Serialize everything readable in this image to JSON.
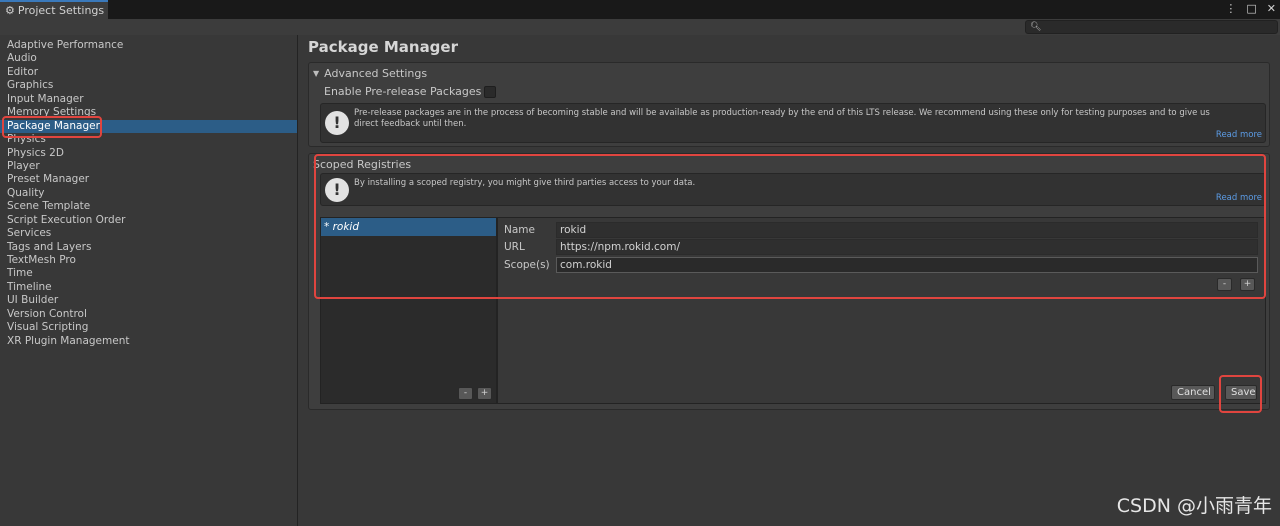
{
  "window": {
    "tab_title": "Project Settings",
    "menu_glyph": "⋮",
    "maximize_glyph": "□",
    "close_glyph": "✕"
  },
  "search": {
    "placeholder": "",
    "value": ""
  },
  "sidebar": {
    "items": [
      {
        "label": "Adaptive Performance"
      },
      {
        "label": "Audio"
      },
      {
        "label": "Editor"
      },
      {
        "label": "Graphics"
      },
      {
        "label": "Input Manager"
      },
      {
        "label": "Memory Settings"
      },
      {
        "label": "Package Manager",
        "selected": true
      },
      {
        "label": "Physics"
      },
      {
        "label": "Physics 2D"
      },
      {
        "label": "Player"
      },
      {
        "label": "Preset Manager"
      },
      {
        "label": "Quality"
      },
      {
        "label": "Scene Template"
      },
      {
        "label": "Script Execution Order"
      },
      {
        "label": "Services"
      },
      {
        "label": "Tags and Layers"
      },
      {
        "label": "TextMesh Pro"
      },
      {
        "label": "Time"
      },
      {
        "label": "Timeline"
      },
      {
        "label": "UI Builder"
      },
      {
        "label": "Version Control"
      },
      {
        "label": "Visual Scripting"
      },
      {
        "label": "XR Plugin Management"
      }
    ]
  },
  "main": {
    "title": "Package Manager",
    "advanced": {
      "header": "Advanced Settings",
      "enable_prerelease_label": "Enable Pre-release Packages",
      "enable_prerelease_checked": false,
      "help_text": "Pre-release packages are in the process of becoming stable and will be available as production-ready by the end of this LTS release. We recommend using these only for testing purposes and to give us direct feedback until then.",
      "read_more": "Read more"
    },
    "scoped": {
      "header": "Scoped Registries",
      "help_text": "By installing a scoped registry, you might give third parties access to your data.",
      "read_more": "Read more",
      "registries": [
        {
          "label": "* rokid"
        }
      ],
      "fields": {
        "name_label": "Name",
        "name_value": "rokid",
        "url_label": "URL",
        "url_value": "https://npm.rokid.com/",
        "scope_label": "Scope(s)",
        "scope_value": "com.rokid"
      },
      "minus_label": "-",
      "plus_label": "+",
      "cancel_label": "Cancel",
      "save_label": "Save"
    }
  },
  "watermark": "CSDN @小雨青年",
  "colors": {
    "selection": "#2c5d87",
    "link": "#5c9ce6",
    "annotation": "#e0453f"
  }
}
